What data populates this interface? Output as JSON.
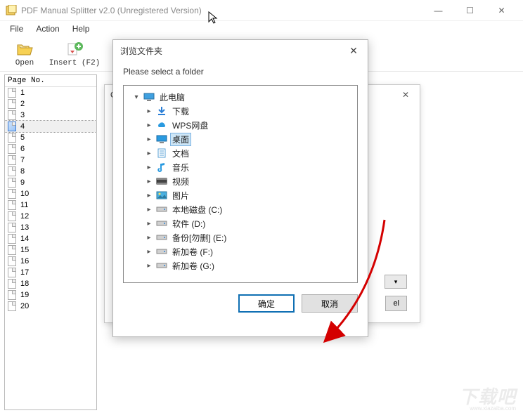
{
  "window": {
    "title": "PDF Manual Splitter v2.0 (Unregistered Version)",
    "min": "—",
    "max": "☐",
    "close": "✕"
  },
  "menu": {
    "file": "File",
    "action": "Action",
    "help": "Help"
  },
  "toolbar": {
    "open": "Open",
    "insert": "Insert (F2)"
  },
  "sidebar": {
    "header": "Page No.",
    "pages": [
      "1",
      "2",
      "3",
      "4",
      "5",
      "6",
      "7",
      "8",
      "9",
      "10",
      "11",
      "12",
      "13",
      "14",
      "15",
      "16",
      "17",
      "18",
      "19",
      "20"
    ],
    "selected_index": 3
  },
  "bg_dialog": {
    "title_prefix": "O",
    "close": "✕",
    "combo_arrow": "▾",
    "cancel_suffix": "el"
  },
  "folder_dialog": {
    "title": "浏览文件夹",
    "close": "✕",
    "prompt": "Please select a folder",
    "tree": {
      "root": {
        "label": "此电脑",
        "expanded": true
      },
      "children": [
        {
          "label": "下载",
          "icon": "download"
        },
        {
          "label": "WPS网盘",
          "icon": "cloud"
        },
        {
          "label": "桌面",
          "icon": "desktop",
          "selected": true
        },
        {
          "label": "文档",
          "icon": "doc"
        },
        {
          "label": "音乐",
          "icon": "music"
        },
        {
          "label": "视频",
          "icon": "video"
        },
        {
          "label": "图片",
          "icon": "picture"
        },
        {
          "label": "本地磁盘 (C:)",
          "icon": "disk"
        },
        {
          "label": "软件 (D:)",
          "icon": "disk"
        },
        {
          "label": "备份[勿删] (E:)",
          "icon": "disk"
        },
        {
          "label": "新加卷 (F:)",
          "icon": "disk"
        },
        {
          "label": "新加卷 (G:)",
          "icon": "disk"
        }
      ]
    },
    "ok": "确定",
    "cancel": "取消"
  },
  "watermark": {
    "main": "下载吧",
    "sub": "www.xiazaiba.com"
  }
}
